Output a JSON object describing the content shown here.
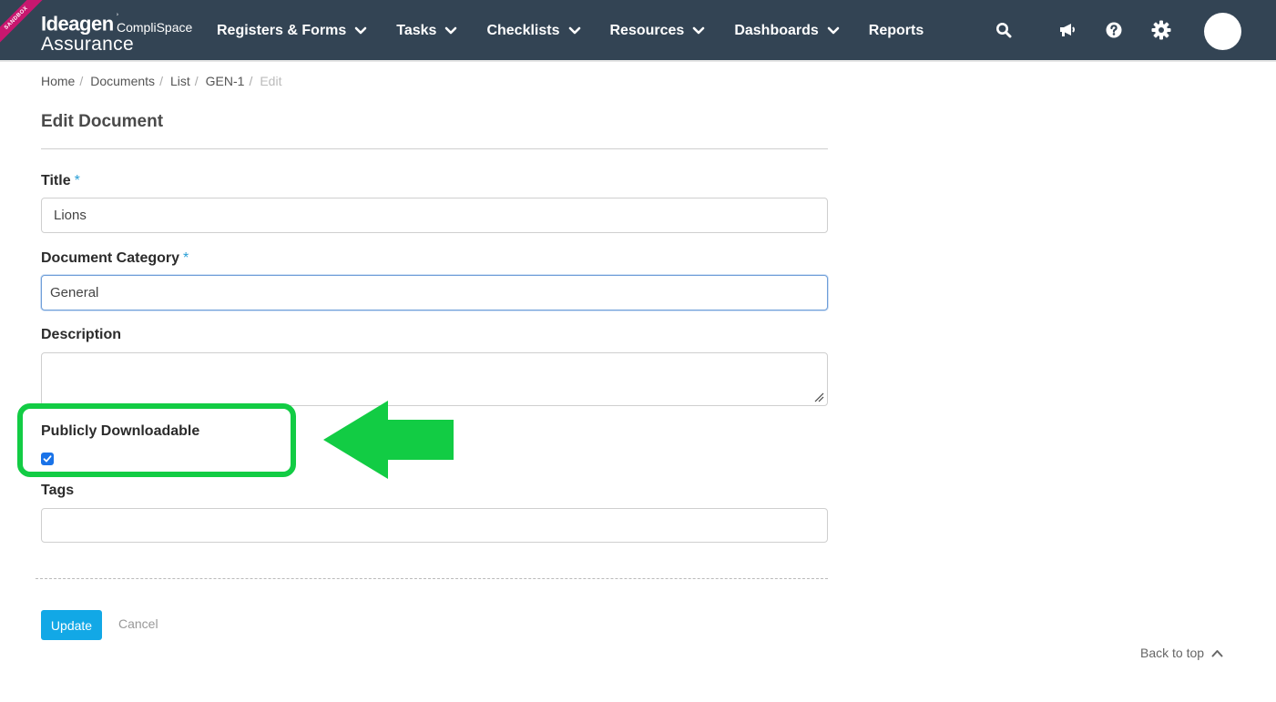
{
  "brand": {
    "ribbon": "SANDBOX",
    "ideagen": "Ideagen",
    "complispace": "CompliSpace",
    "product": "Assurance"
  },
  "nav": {
    "items": [
      {
        "label": "Registers & Forms",
        "dropdown": true
      },
      {
        "label": "Tasks",
        "dropdown": true
      },
      {
        "label": "Checklists",
        "dropdown": true
      },
      {
        "label": "Resources",
        "dropdown": true
      },
      {
        "label": "Dashboards",
        "dropdown": true
      },
      {
        "label": "Reports",
        "dropdown": false
      }
    ],
    "icons": [
      "search-icon",
      "megaphone-icon",
      "help-icon",
      "gear-icon",
      "avatar"
    ]
  },
  "breadcrumb": [
    "Home",
    "Documents",
    "List",
    "GEN-1",
    "Edit"
  ],
  "form": {
    "heading": "Edit Document",
    "title_label": "Title",
    "title_value": "Lions",
    "category_label": "Document Category",
    "category_value": "General",
    "description_label": "Description",
    "description_value": "",
    "public_label": "Publicly Downloadable",
    "public_checked": true,
    "tags_label": "Tags",
    "tags_value": "",
    "required_mark": "*"
  },
  "actions": {
    "update": "Update",
    "cancel": "Cancel"
  },
  "footer": {
    "back_to_top": "Back to top"
  },
  "colors": {
    "navbar": "#334454",
    "accent": "#12a8e6",
    "required": "#2a9fd6",
    "annotation": "#12cc44",
    "sandbox_ribbon": "#c8176f"
  }
}
